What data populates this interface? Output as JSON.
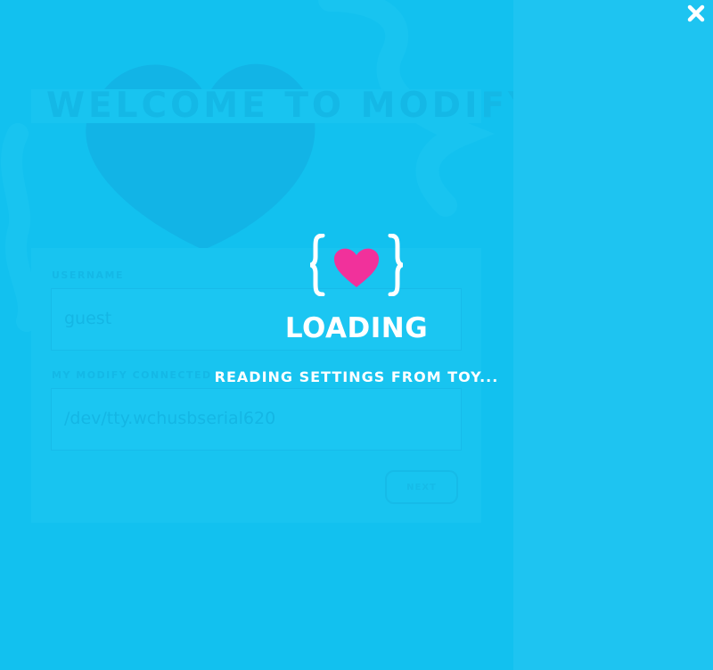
{
  "colors": {
    "background": "#1ec4f1",
    "panel": "#12c1ef",
    "heart": "#f1319b",
    "text": "#ffffff"
  },
  "background_app": {
    "title": "WELCOME TO MODIFY",
    "username_label": "USERNAME",
    "username_value": "guest",
    "port_label": "MY MODIFY CONNECTED",
    "port_value": "/dev/tty.wchusbserial620",
    "submit_label": "NEXT"
  },
  "overlay": {
    "logo_icon": "heart-in-braces-logo",
    "title": "LOADING",
    "status": "READING SETTINGS FROM TOY..."
  },
  "window": {
    "close_icon": "close-x-icon"
  }
}
